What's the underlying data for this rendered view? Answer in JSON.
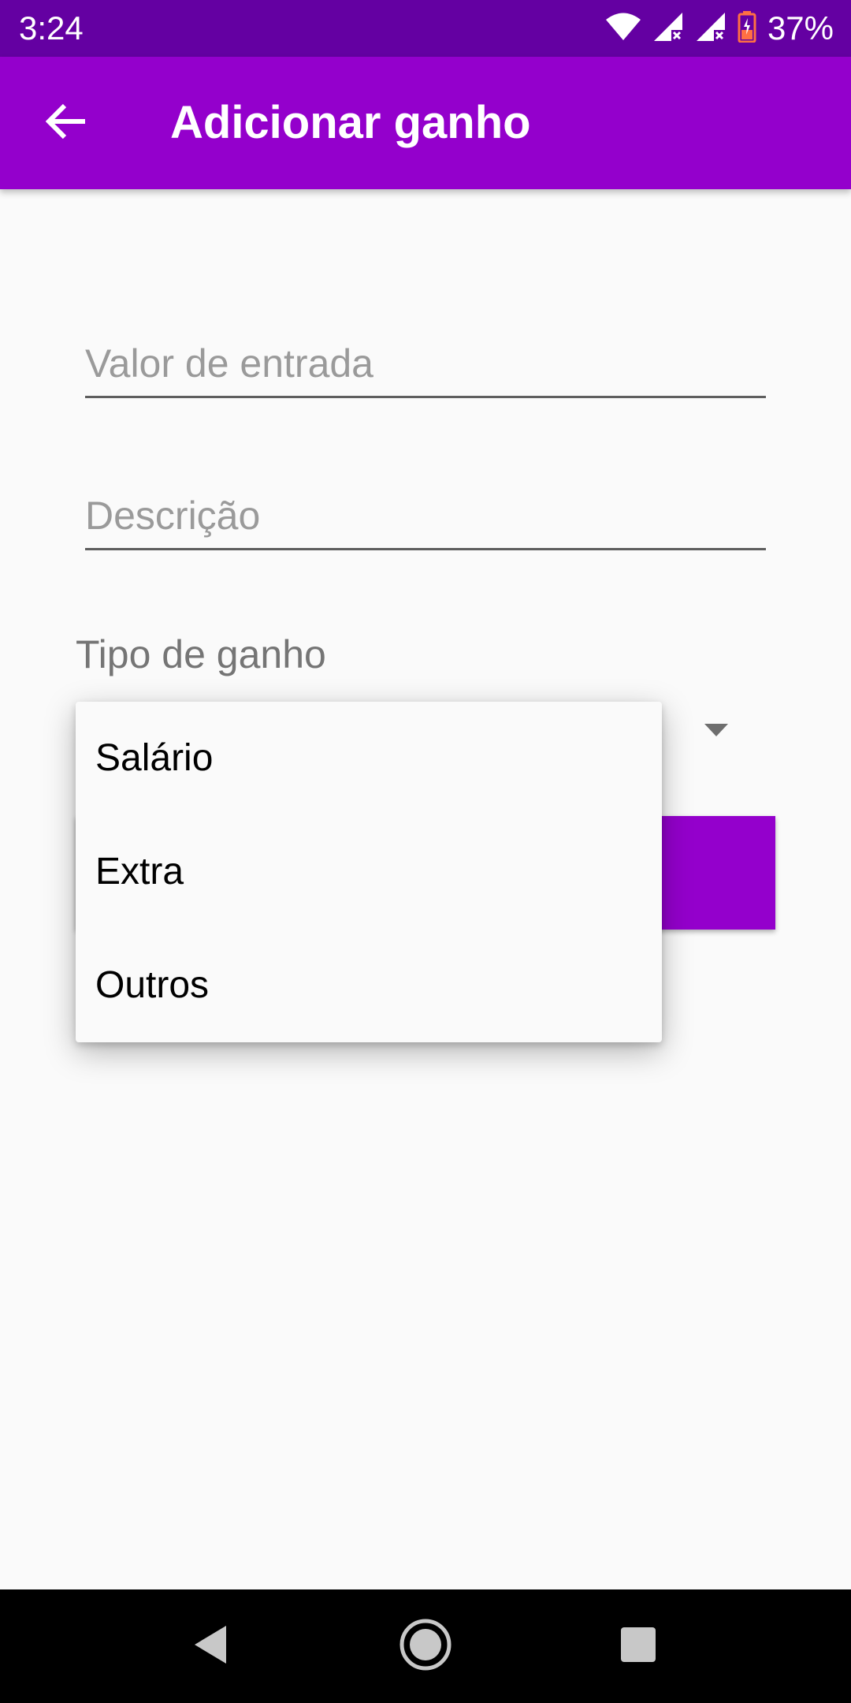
{
  "status_bar": {
    "time": "3:24",
    "battery_percent": "37%",
    "icons": [
      "wifi-icon",
      "signal-icon",
      "signal-icon",
      "battery-charging-icon"
    ]
  },
  "app_bar": {
    "title": "Adicionar ganho",
    "back_icon": "arrow-back-icon"
  },
  "form": {
    "valor_placeholder": "Valor de entrada",
    "descricao_placeholder": "Descrição",
    "tipo_label": "Tipo de ganho"
  },
  "dropdown": {
    "options": [
      "Salário",
      "Extra",
      "Outros"
    ]
  },
  "nav_bar": {
    "icons": [
      "nav-back-icon",
      "nav-home-icon",
      "nav-recents-icon"
    ]
  },
  "colors": {
    "status_bar": "#6400A2",
    "app_bar": "#9400CC",
    "background": "#FAFAFA",
    "battery": "#FF7043"
  }
}
